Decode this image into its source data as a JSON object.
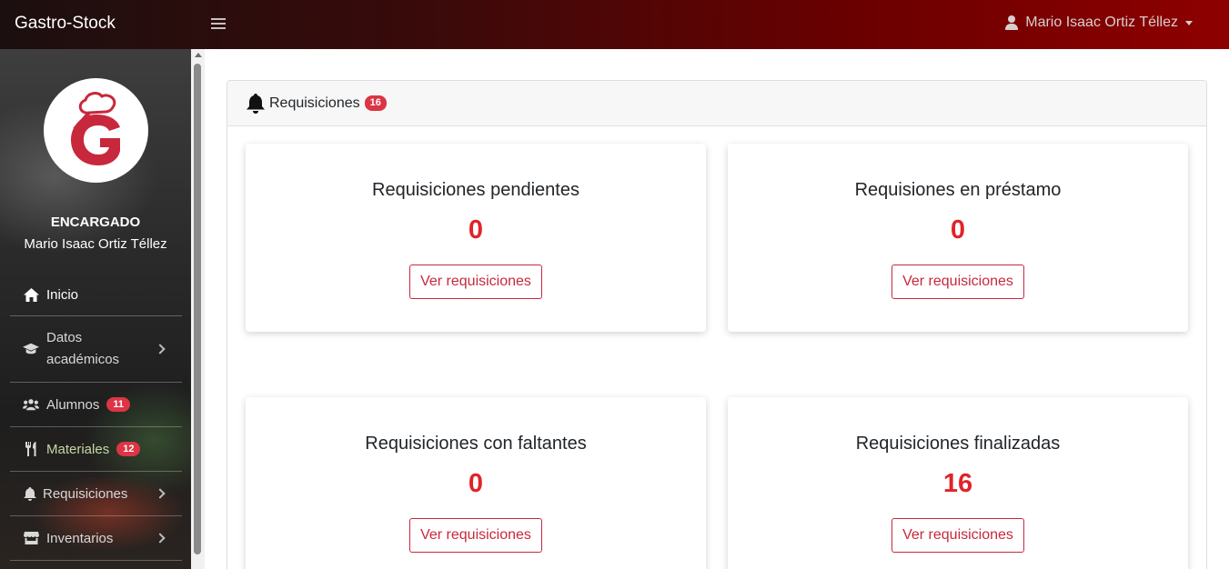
{
  "app": {
    "brand": "Gastro-Stock"
  },
  "topbar": {
    "user_name": "Mario Isaac Ortiz Téllez"
  },
  "sidebar": {
    "role": "ENCARGADO",
    "user_name": "Mario Isaac Ortiz Téllez",
    "items": [
      {
        "label": "Inicio",
        "icon": "home-icon"
      },
      {
        "label": "Datos académicos",
        "icon": "graduation-cap-icon"
      },
      {
        "label": "Alumnos",
        "icon": "users-icon",
        "badge": "11"
      },
      {
        "label": "Materiales",
        "icon": "utensils-icon",
        "badge": "12"
      },
      {
        "label": "Requisiciones",
        "icon": "bell-icon"
      },
      {
        "label": "Inventarios",
        "icon": "store-icon"
      }
    ]
  },
  "panel": {
    "title": "Requisiciones",
    "badge": "16",
    "cards": [
      {
        "title": "Requisiciones pendientes",
        "count": "0",
        "button": "Ver requisiciones"
      },
      {
        "title": "Requisiones en préstamo",
        "count": "0",
        "button": "Ver requisiciones"
      },
      {
        "title": "Requisiciones con faltantes",
        "count": "0",
        "button": "Ver requisiciones"
      },
      {
        "title": "Requisiciones finalizadas",
        "count": "16",
        "button": "Ver requisiciones"
      }
    ]
  },
  "colors": {
    "accent": "#dc3545",
    "count": "#e0242a",
    "topbar_end": "#8e0000"
  }
}
